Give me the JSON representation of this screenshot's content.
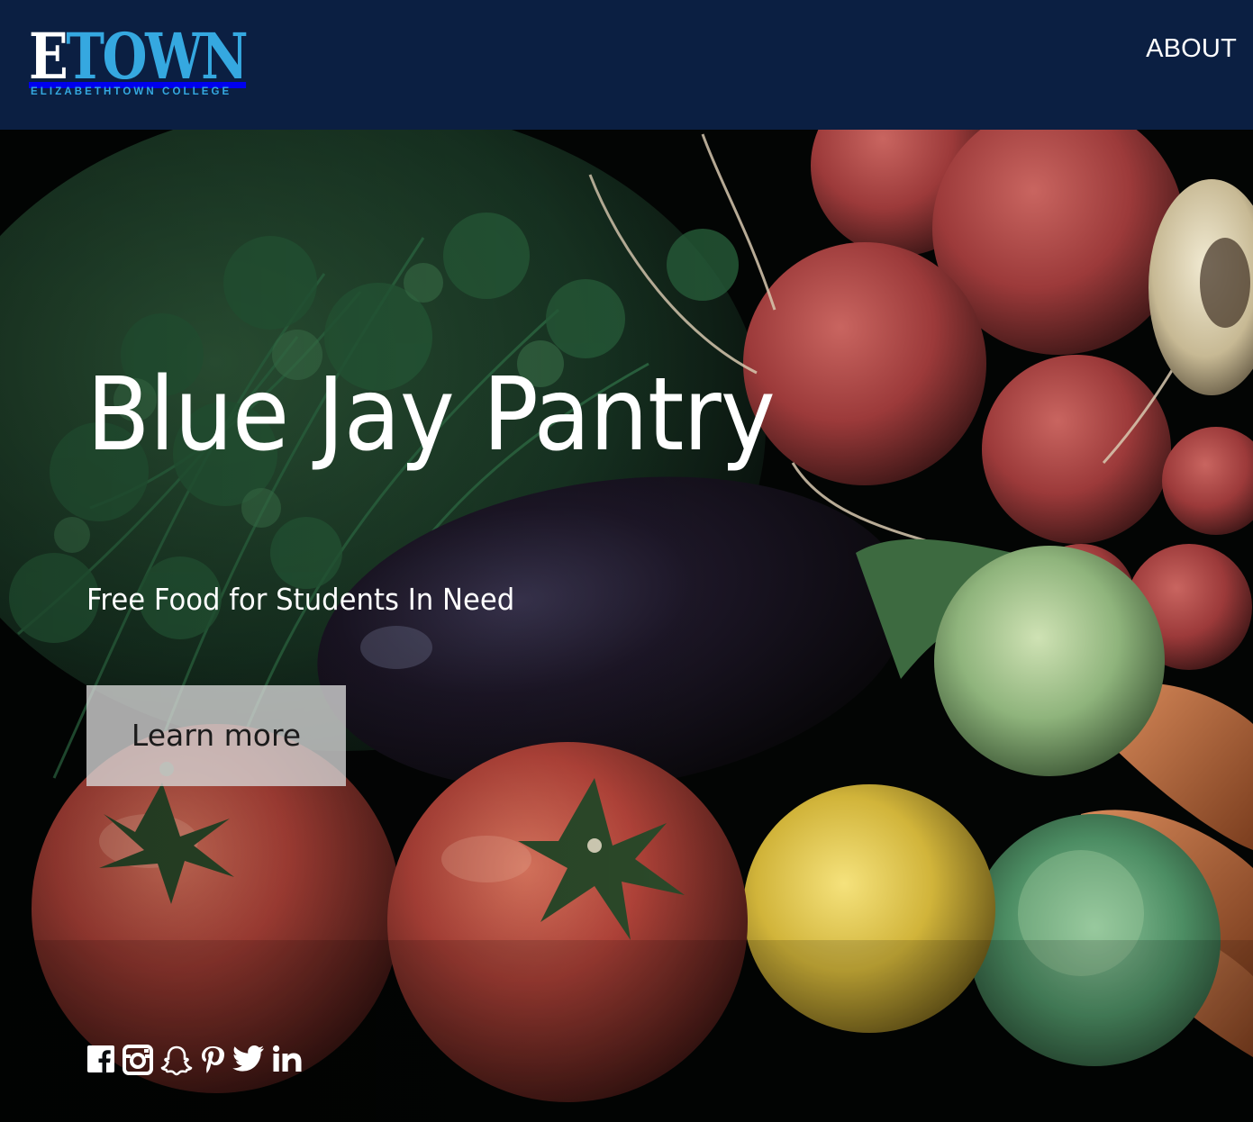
{
  "header": {
    "logo": {
      "word_first": "E",
      "word_rest": "TOWN",
      "subtitle": "ELIZABETHTOWN COLLEGE"
    },
    "nav": {
      "about_label": "ABOUT"
    },
    "background_color": "#0b1f42",
    "accent_color": "#35a8e0"
  },
  "hero": {
    "title": "Blue Jay Pantry",
    "subtitle": "Free Food for Students In Need",
    "cta_label": "Learn more",
    "background_image": "vegetables-photo"
  },
  "social": {
    "links": [
      {
        "name": "facebook",
        "icon": "facebook-icon"
      },
      {
        "name": "instagram",
        "icon": "instagram-icon"
      },
      {
        "name": "snapchat",
        "icon": "snapchat-icon"
      },
      {
        "name": "pinterest",
        "icon": "pinterest-icon"
      },
      {
        "name": "twitter",
        "icon": "twitter-icon"
      },
      {
        "name": "linkedin",
        "icon": "linkedin-icon"
      }
    ]
  }
}
